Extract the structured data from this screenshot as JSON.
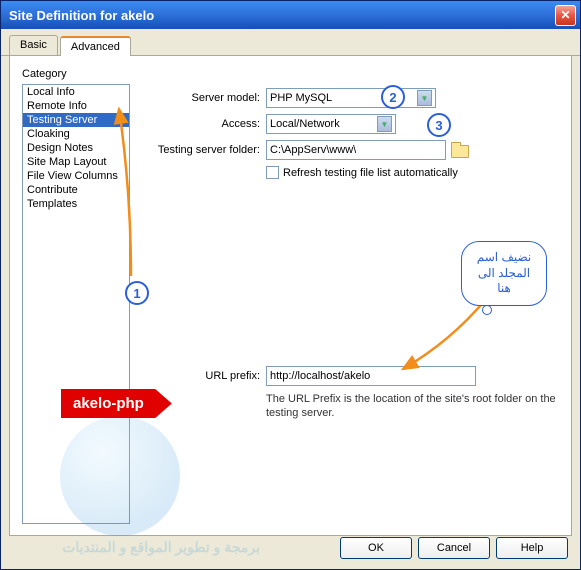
{
  "window": {
    "title": "Site Definition for akelo"
  },
  "tabs": {
    "basic": "Basic",
    "advanced": "Advanced",
    "active": "advanced"
  },
  "category_label": "Category",
  "categories": [
    "Local Info",
    "Remote Info",
    "Testing Server",
    "Cloaking",
    "Design Notes",
    "Site Map Layout",
    "File View Columns",
    "Contribute",
    "Templates"
  ],
  "selected_category": "Testing Server",
  "form": {
    "server_model_label": "Server model:",
    "server_model_value": "PHP MySQL",
    "access_label": "Access:",
    "access_value": "Local/Network",
    "folder_label": "Testing server folder:",
    "folder_value": "C:\\AppServ\\www\\",
    "refresh_label": "Refresh testing file list automatically"
  },
  "prefix": {
    "label": "URL prefix:",
    "value": "http://localhost/akelo",
    "help": "The URL Prefix is the location of the site's root folder on the testing server."
  },
  "buttons": {
    "ok": "OK",
    "cancel": "Cancel",
    "help": "Help"
  },
  "annotations": {
    "n1": "1",
    "n2": "2",
    "n3": "3",
    "cloud": "نضيف اسم المجلد الى هنا",
    "banner": "akelo-php"
  },
  "watermark": "برمجة و تطوير المواقع و المنتديات"
}
